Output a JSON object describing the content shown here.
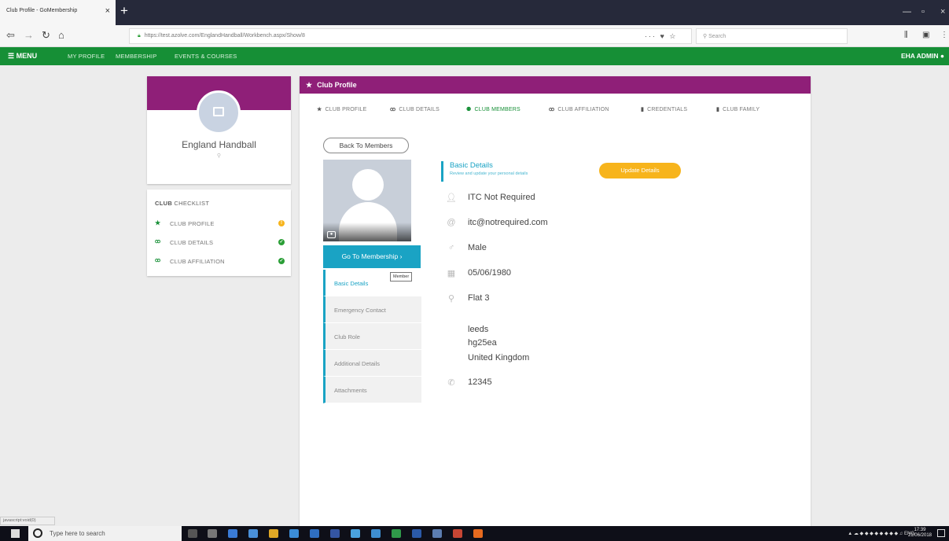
{
  "browser": {
    "tab_title": "Club Profile - GoMembership",
    "url": "https://test.azolve.com/EnglandHandball/Workbench.aspx/Show/8",
    "search_placeholder": "Search",
    "status_text": "javascript:void(0)"
  },
  "appbar": {
    "menu_label": "MENU",
    "links": [
      "MY PROFILE",
      "MEMBERSHIP",
      "EVENTS & COURSES"
    ],
    "user": "EHA ADMIN"
  },
  "club_card": {
    "name": "England Handball"
  },
  "checklist": {
    "title_bold": "CLUB",
    "title_rest": " CHECKLIST",
    "items": [
      {
        "label": "CLUB PROFILE",
        "icon": "star-icon",
        "status": "warning",
        "status_color": "#f7b41c"
      },
      {
        "label": "CLUB DETAILS",
        "icon": "group-icon",
        "status": "complete",
        "status_color": "#2a9e36"
      },
      {
        "label": "CLUB AFFILIATION",
        "icon": "group-icon",
        "status": "complete",
        "status_color": "#2a9e36"
      }
    ]
  },
  "main": {
    "header": "Club Profile",
    "tabs": [
      {
        "label": "CLUB PROFILE",
        "icon": "star-icon"
      },
      {
        "label": "CLUB DETAILS",
        "icon": "group-icon"
      },
      {
        "label": "CLUB MEMBERS",
        "icon": "members-icon",
        "active": true
      },
      {
        "label": "CLUB AFFILIATION",
        "icon": "group-icon"
      },
      {
        "label": "CREDENTIALS",
        "icon": "bookmark-icon"
      },
      {
        "label": "CLUB FAMILY",
        "icon": "bookmark-icon"
      }
    ],
    "back_button": "Back To Members",
    "goto_button": "Go To Membership ›",
    "side_menu": [
      {
        "label": "Basic Details",
        "active": true,
        "tag": "Member"
      },
      {
        "label": "Emergency Contact"
      },
      {
        "label": "Club Role"
      },
      {
        "label": "Additional Details"
      },
      {
        "label": "Attachments"
      }
    ],
    "section": {
      "title": "Basic Details",
      "subtitle": "Review and update your personal details",
      "update_button": "Update Details"
    },
    "details": {
      "name": "ITC Not Required",
      "email": "itc@notrequired.com",
      "gender": "Male",
      "dob": "05/06/1980",
      "address_line1": "Flat 3",
      "address_lines": [
        "leeds",
        "hg25ea",
        "United Kingdom"
      ],
      "phone": "12345"
    }
  },
  "taskbar": {
    "search_placeholder": "Type here to search",
    "language": "ENG",
    "time": "17:39",
    "date": "21/06/2018"
  },
  "colors": {
    "brand_purple": "#8f1f78",
    "brand_green": "#168f36",
    "accent_teal": "#1aa3c4",
    "accent_yellow": "#f7b41c"
  }
}
